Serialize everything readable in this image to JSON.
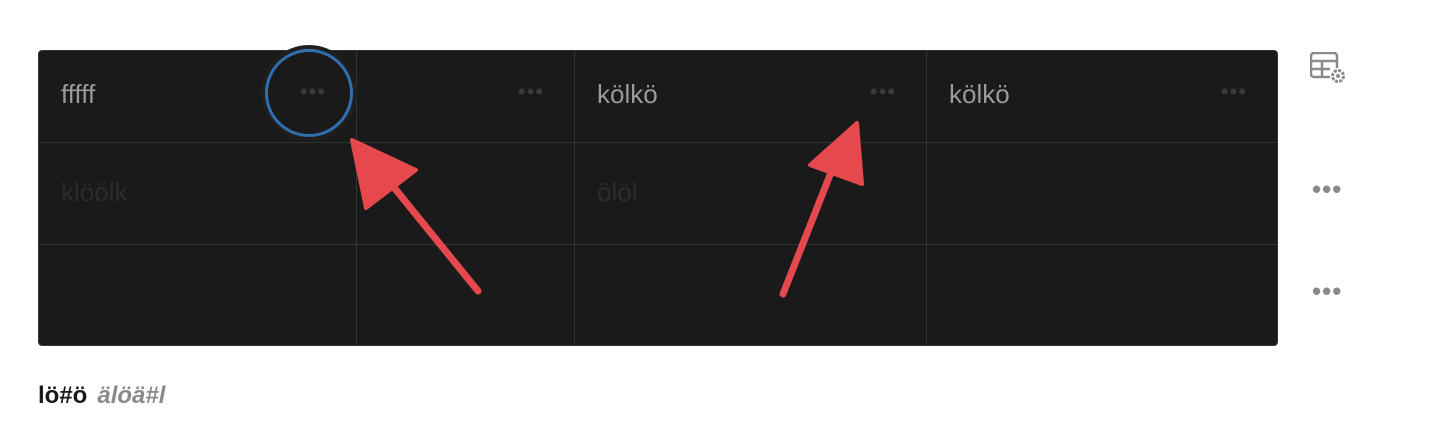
{
  "table": {
    "rows": [
      [
        {
          "text": "fffff",
          "faint": false
        },
        {
          "text": "",
          "faint": false
        },
        {
          "text": "kölkö",
          "faint": false
        },
        {
          "text": "kölkö",
          "faint": false
        }
      ],
      [
        {
          "text": "klöölk",
          "faint": true
        },
        {
          "text": "",
          "faint": true
        },
        {
          "text": "ölöl",
          "faint": true
        },
        {
          "text": "",
          "faint": true
        }
      ],
      [
        {
          "text": "",
          "faint": false
        },
        {
          "text": "",
          "faint": false
        },
        {
          "text": "",
          "faint": false
        },
        {
          "text": "",
          "faint": false
        }
      ]
    ],
    "cell_menu_glyph": "•••"
  },
  "side": {
    "table_settings_icon": "table-settings-icon",
    "row_menu_glyph": "•••"
  },
  "caption": {
    "bold_text": "lö#ö",
    "italic_text": "älöä#l"
  },
  "colors": {
    "table_bg": "#1a1a1a",
    "highlight_ring": "#2f6fae",
    "arrow": "#e5484d"
  }
}
